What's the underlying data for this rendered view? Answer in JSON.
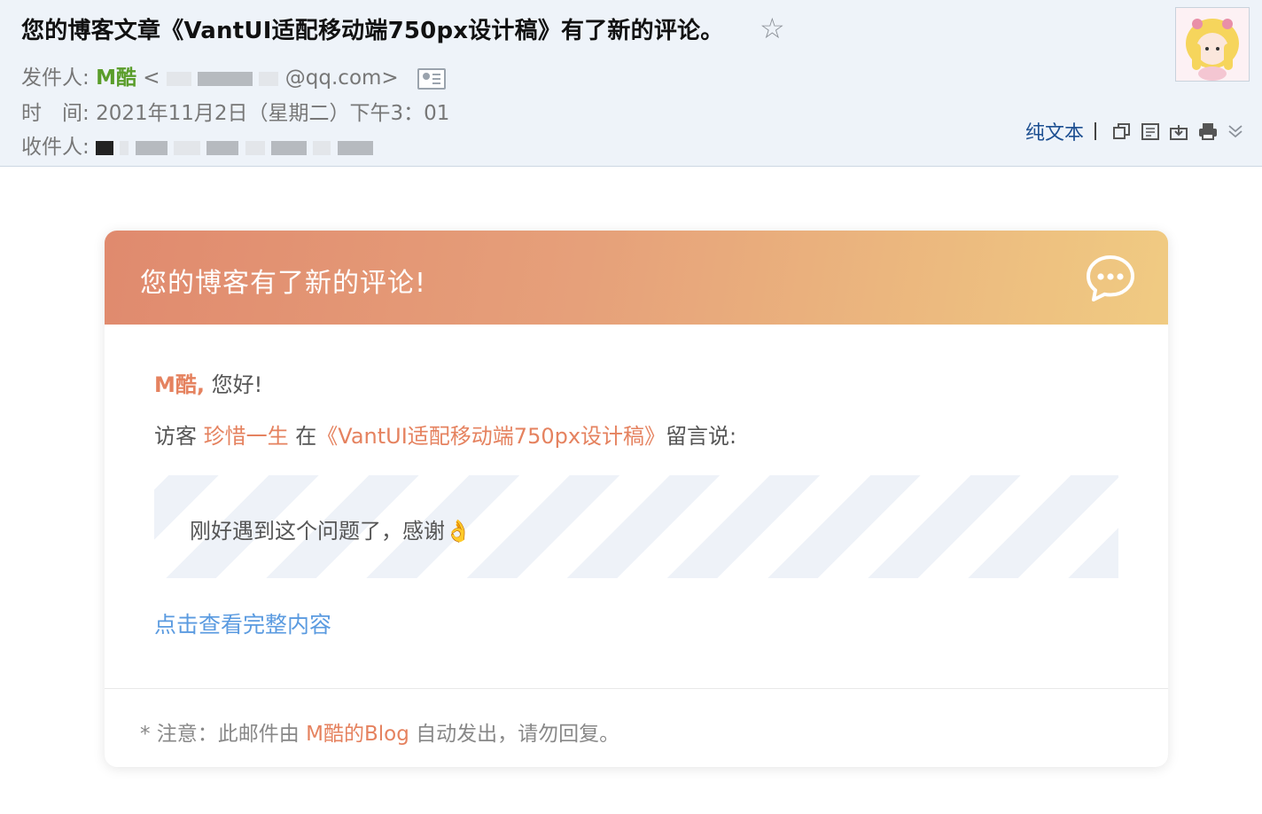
{
  "mail": {
    "subject": "您的博客文章《VantUI适配移动端750px设计稿》有了新的评论。",
    "star_icon": "star-outline-icon",
    "from_label": "发件人:",
    "from_name": "M酷",
    "from_email_open": "<",
    "from_email_visible": "@qq.com>",
    "time_label": "时　间:",
    "time_value": "2021年11月2日（星期二）下午3：01",
    "to_label": "收件人:",
    "plain_text_label": "纯文本",
    "toolbar_icons": [
      "new-window-icon",
      "note-icon",
      "download-icon",
      "print-icon",
      "more-chevron-icon"
    ]
  },
  "card": {
    "header_title": "您的博客有了新的评论!",
    "chat_icon": "chat-bubble-icon",
    "greeting_name": "M酷,",
    "greeting_text": "您好!",
    "visitor_prefix": "访客",
    "visitor_name": "珍惜一生",
    "visitor_in": "在",
    "article_title": "《VantUI适配移动端750px设计稿》",
    "visitor_suffix": "留言说:",
    "comment": "刚好遇到这个问题了，感谢👌",
    "view_link": "点击查看完整内容",
    "footer_prefix": "* 注意：此邮件由",
    "footer_blog": "M酷的Blog",
    "footer_suffix": "自动发出，请勿回复。"
  },
  "colors": {
    "accent": "#e5825f",
    "link": "#5b9be0",
    "sender": "#5a9d2a",
    "header_gradient_start": "#e08a6e",
    "header_gradient_end": "#f0cb82"
  }
}
